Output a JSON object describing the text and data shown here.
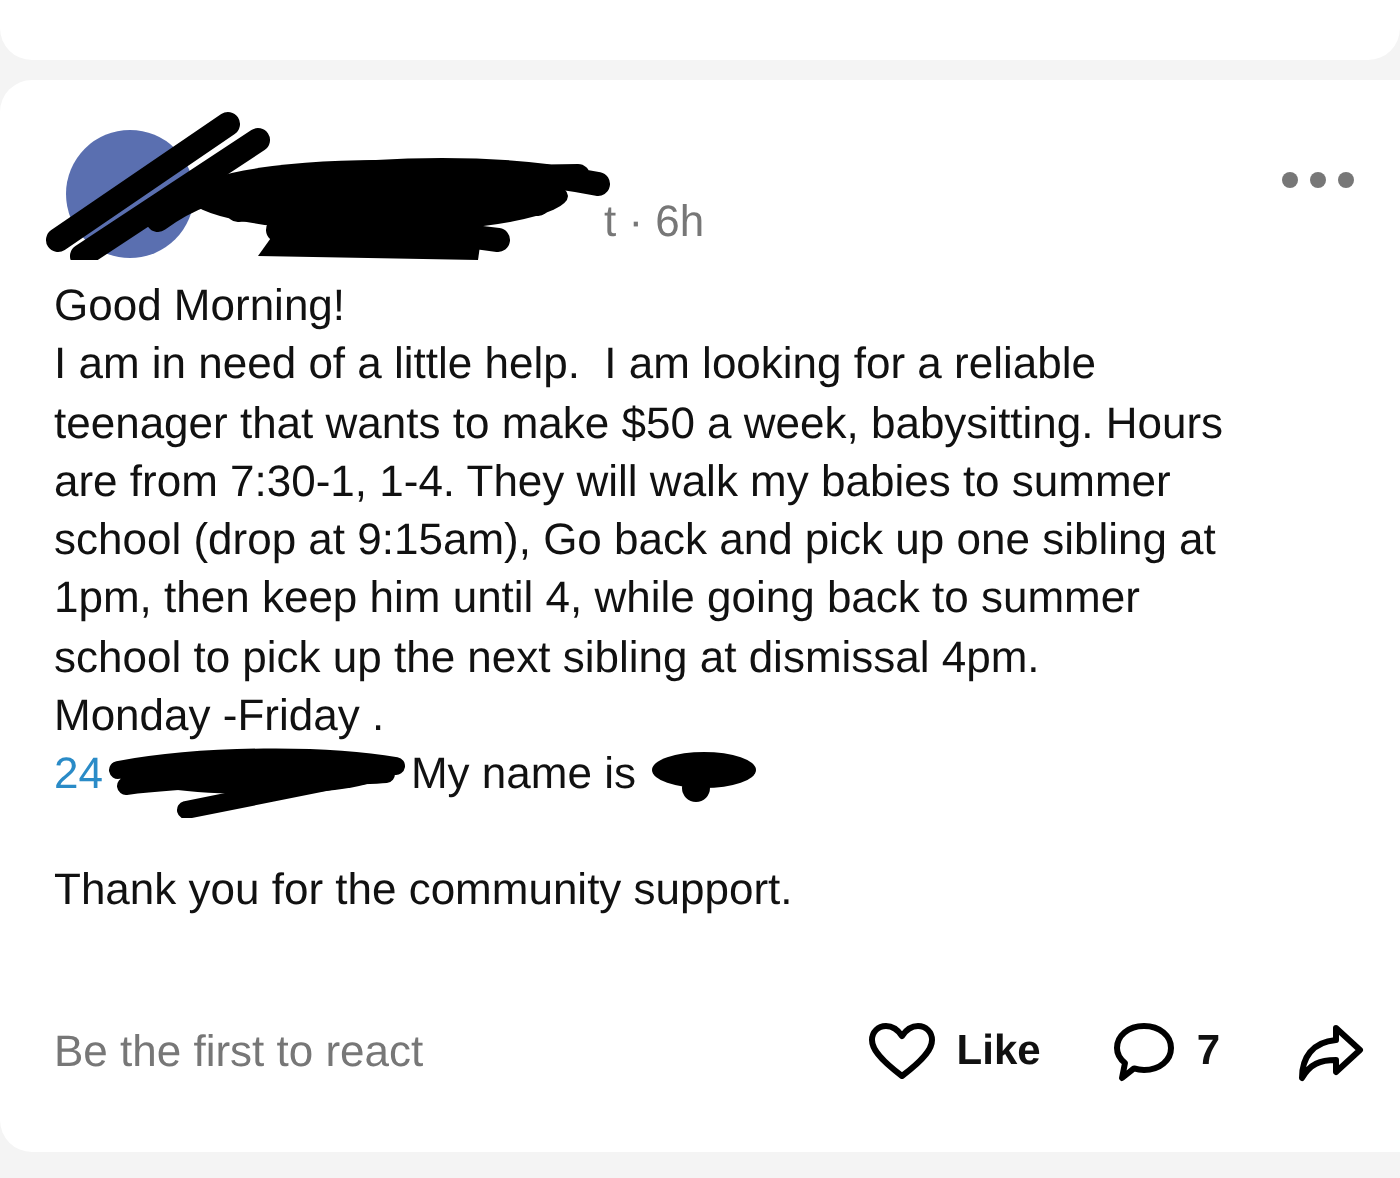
{
  "post": {
    "author_meta": "t · 6h",
    "paragraphs": [
      "Good Morning!",
      "I am in need of a little help.  I am looking for a reliable teenager that wants to make $50 a week, babysitting. Hours are from 7:30-1, 1-4. They will walk my babies to summer school (drop at 9:15am), Go back and pick up one sibling at 1pm, then keep him until 4, while going back to summer school to pick up the next sibling at dismissal 4pm.",
      "Monday -Friday ."
    ],
    "contact": {
      "phone_link": "24",
      "text": "My name is"
    },
    "closing": "Thank you for the community support.",
    "reactions_summary": "Be the first to react",
    "like_label": "Like",
    "comment_count": "7"
  }
}
